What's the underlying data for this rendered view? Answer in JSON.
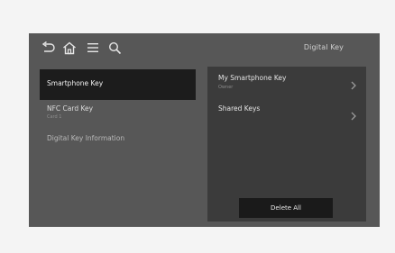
{
  "header": {
    "title": "Digital Key",
    "icons": [
      "back-icon",
      "home-icon",
      "menu-icon",
      "search-icon"
    ]
  },
  "left_menu": {
    "items": [
      {
        "label": "Smartphone Key",
        "sublabel": "",
        "selected": true
      },
      {
        "label": "NFC Card Key",
        "sublabel": "Card 1",
        "selected": false
      },
      {
        "label": "Digital Key Information",
        "sublabel": "",
        "selected": false
      }
    ]
  },
  "right_panel": {
    "rows": [
      {
        "label": "My Smartphone Key",
        "sublabel": "Owner"
      },
      {
        "label": "Shared Keys",
        "sublabel": ""
      }
    ],
    "delete_all_label": "Delete All"
  },
  "colors": {
    "background": "#575757",
    "panel": "#3b3b3b",
    "selected": "#1c1c1c",
    "text": "#e4e4e4"
  }
}
